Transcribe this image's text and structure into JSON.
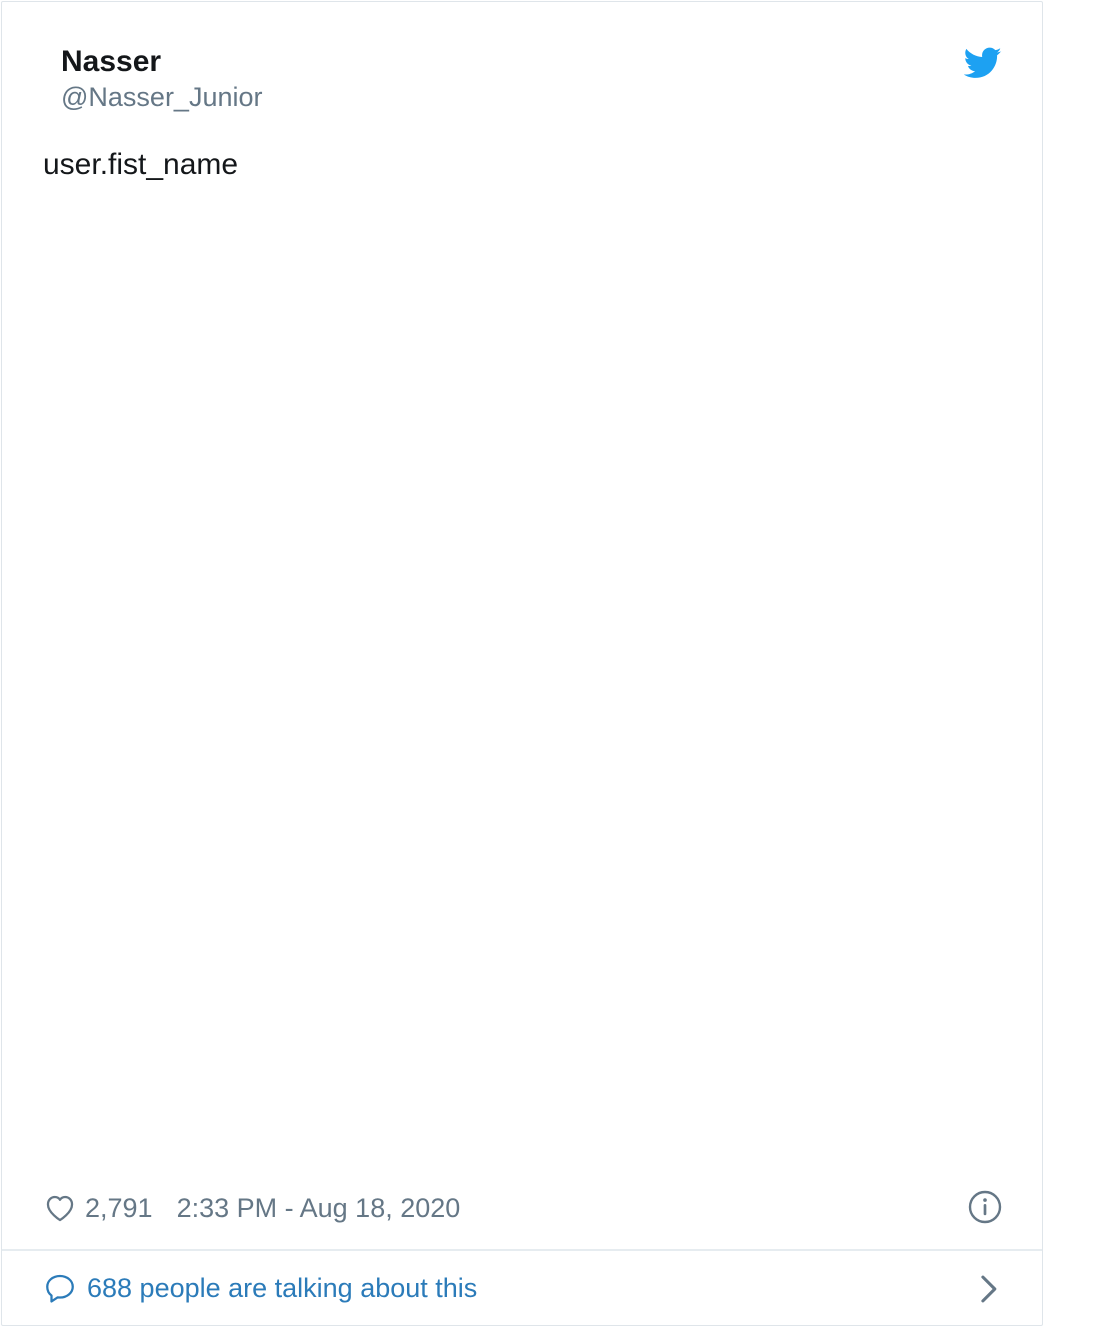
{
  "tweet": {
    "author_name": "Nasser",
    "author_handle": "@Nasser_Junior",
    "text": "user.fist_name",
    "like_count": "2,791",
    "timestamp": "2:33 PM - Aug 18, 2020",
    "conversation_text": "688 people are talking about this"
  },
  "icons": {
    "brand": "twitter-bird-icon",
    "like": "heart-icon",
    "info": "info-icon",
    "conversation": "speech-bubble-icon",
    "more": "chevron-right-icon"
  },
  "colors": {
    "brand": "#1da1f2",
    "link": "#2b7bb9",
    "secondary_text": "#657786",
    "primary_text": "#14171a",
    "border": "#dfe5ea"
  }
}
